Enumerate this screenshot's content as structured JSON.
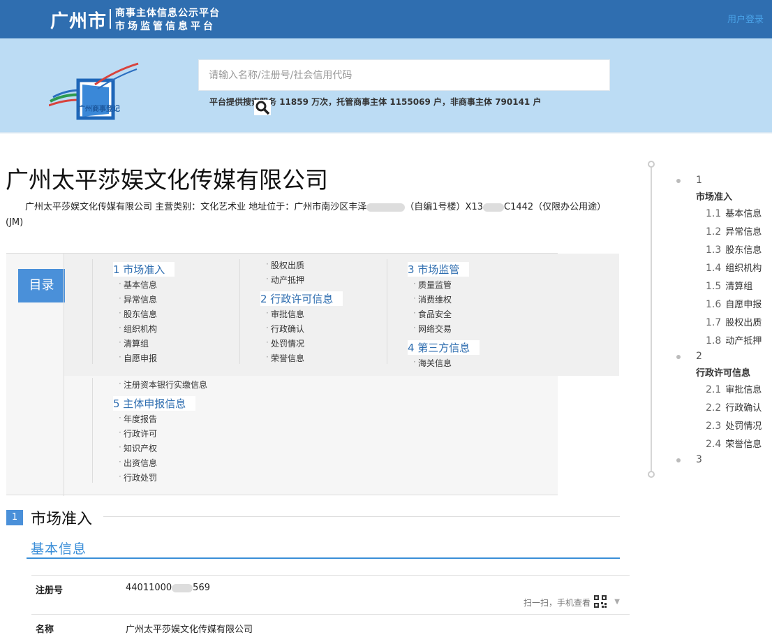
{
  "header": {
    "city": "广州市",
    "platform_line1": "商事主体信息公示平台",
    "platform_line2": "市场监管信息平台",
    "login_label": "用户登录"
  },
  "banner": {
    "logo_text": "广州商事登记",
    "search_placeholder": "请输入名称/注册号/社会信用代码",
    "stats": {
      "prefix": "平台提供搜索服务",
      "searches": "11859",
      "unit1": "万次，托管商事主体",
      "managed": "1155069",
      "unit2": "户，非商事主体",
      "non_commercial": "790141",
      "unit3": "户"
    }
  },
  "company": {
    "name": "广州太平莎娱文化传媒有限公司",
    "desc_part1": "广州太平莎娱文化传媒有限公司 主营类别：文化艺术业 地址位于：广州市南沙区丰泽",
    "desc_part2": "（自编1号楼）X13",
    "desc_part3": "C1442（仅限办公用途）(JM)"
  },
  "toc": {
    "badge": "目录",
    "group1": {
      "head": "1 市场准入",
      "items": [
        "基本信息",
        "异常信息",
        "股东信息",
        "组织机构",
        "清算组",
        "自愿申报"
      ]
    },
    "group1_more": {
      "items": [
        "股权出质",
        "动产抵押"
      ]
    },
    "group2": {
      "head": "2 行政许可信息",
      "items": [
        "审批信息",
        "行政确认",
        "处罚情况",
        "荣誉信息"
      ]
    },
    "group3": {
      "head": "3 市场监管",
      "items": [
        "质量监管",
        "消费维权",
        "食品安全",
        "网络交易"
      ]
    },
    "group4": {
      "head": "4 第三方信息",
      "items": [
        "海关信息"
      ]
    },
    "extra_item": "注册资本银行实缴信息",
    "group5": {
      "head": "5 主体申报信息",
      "items": [
        "年度报告",
        "行政许可",
        "知识产权",
        "出资信息",
        "行政处罚"
      ]
    }
  },
  "section1": {
    "num": "1",
    "title": "市场准入",
    "subtitle": "基本信息",
    "rows": [
      {
        "label": "注册号",
        "value_prefix": "44011000",
        "value_suffix": "569"
      },
      {
        "label": "名称",
        "value": "广州太平莎娱文化传媒有限公司"
      }
    ],
    "qr_text": "扫一扫，手机查看"
  },
  "sidebar": {
    "groups": [
      {
        "num": "1",
        "head": "市场准入",
        "items": [
          {
            "n": "1.1",
            "label": "基本信息"
          },
          {
            "n": "1.2",
            "label": "异常信息"
          },
          {
            "n": "1.3",
            "label": "股东信息"
          },
          {
            "n": "1.4",
            "label": "组织机构"
          },
          {
            "n": "1.5",
            "label": "清算组"
          },
          {
            "n": "1.6",
            "label": "自愿申报"
          },
          {
            "n": "1.7",
            "label": "股权出质"
          },
          {
            "n": "1.8",
            "label": "动产抵押"
          }
        ]
      },
      {
        "num": "2",
        "head": "行政许可信息",
        "items": [
          {
            "n": "2.1",
            "label": "审批信息"
          },
          {
            "n": "2.2",
            "label": "行政确认"
          },
          {
            "n": "2.3",
            "label": "处罚情况"
          },
          {
            "n": "2.4",
            "label": "荣誉信息"
          }
        ]
      },
      {
        "num": "3"
      }
    ]
  }
}
